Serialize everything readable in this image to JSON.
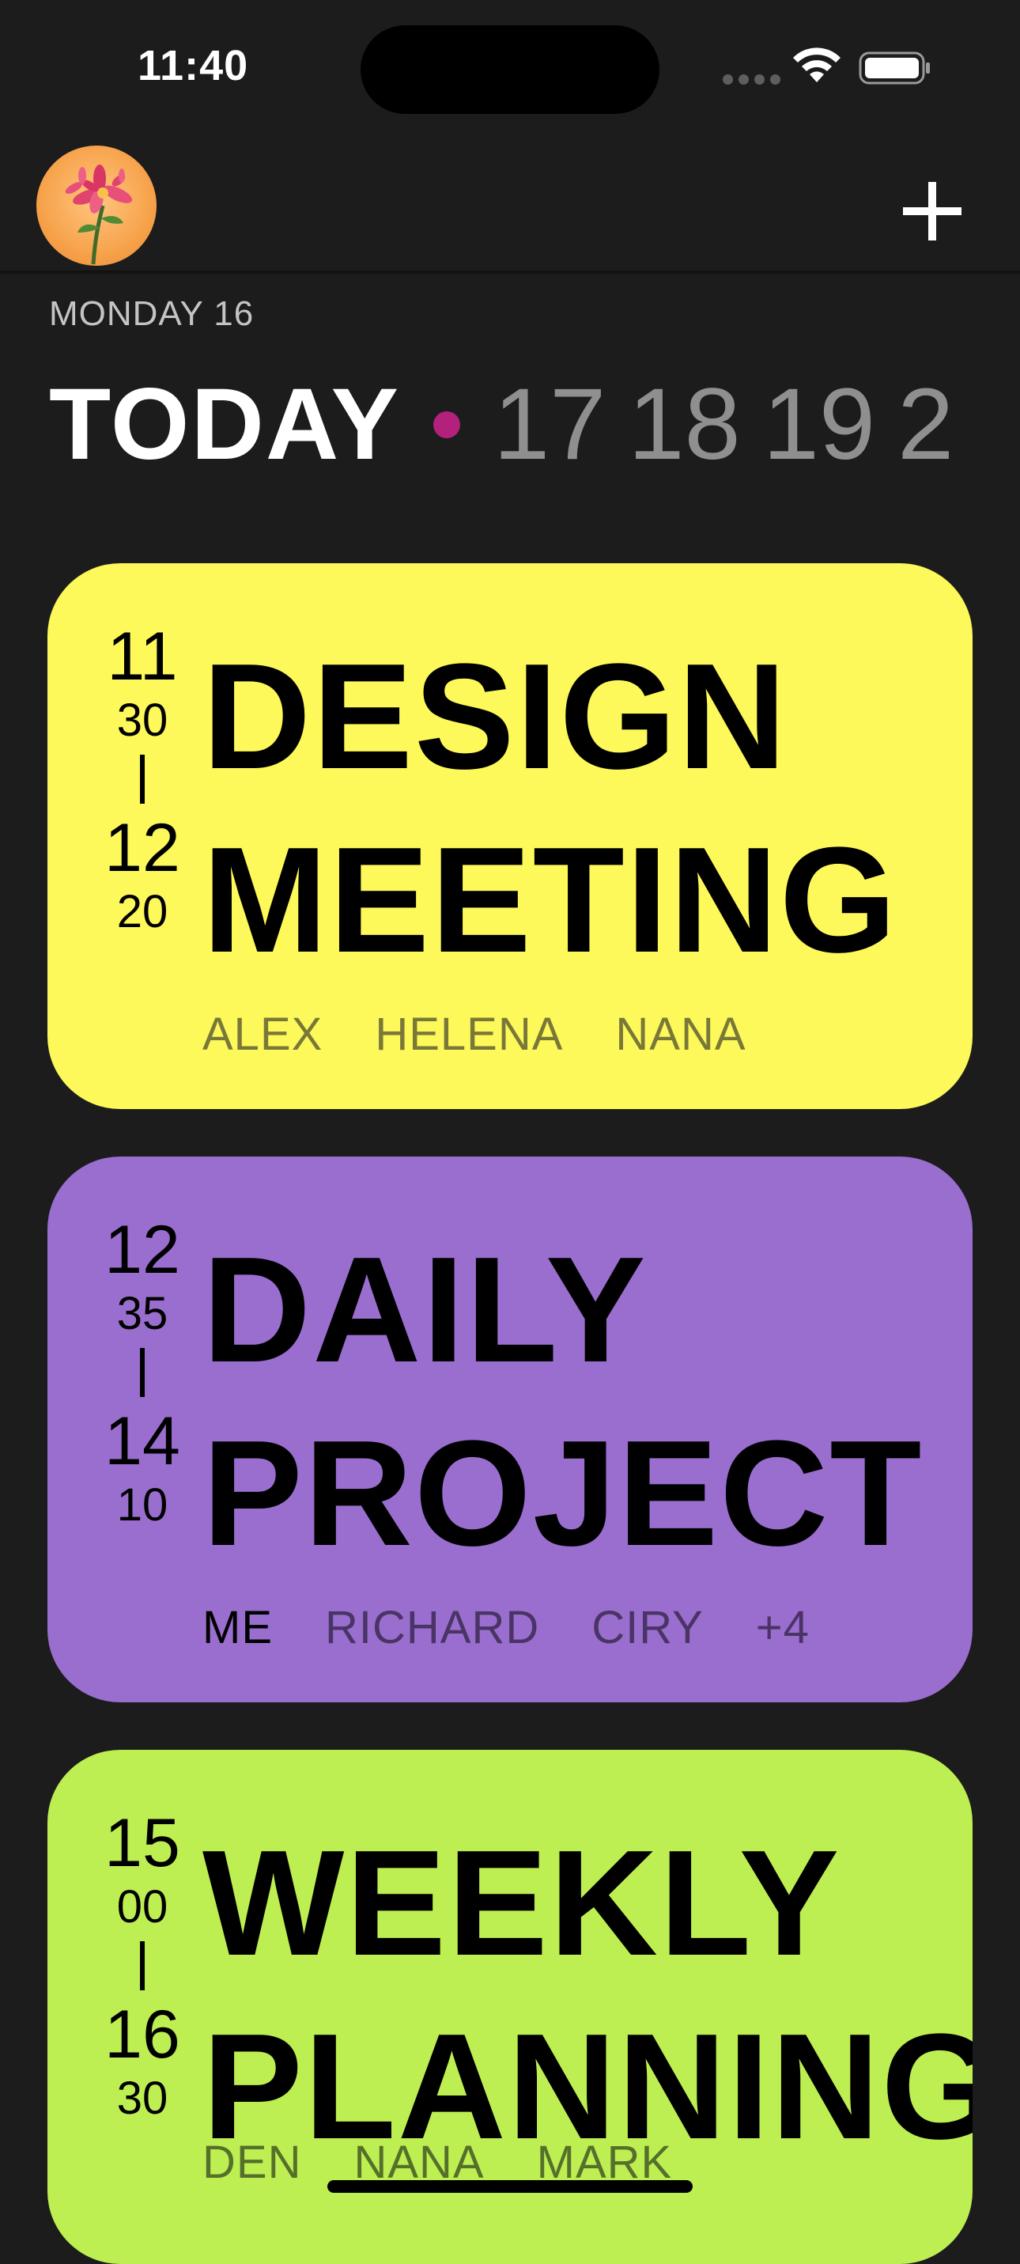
{
  "status_bar": {
    "time": "11:40"
  },
  "header": {
    "avatar_icon": "flower-avatar",
    "add_icon": "plus-icon"
  },
  "date_strip": {
    "day_label": "MONDAY 16",
    "today_label": "TODAY",
    "dates": [
      "17",
      "18",
      "19",
      "2"
    ],
    "accent_dot_color": "#b3217d"
  },
  "events": [
    {
      "color": "#fdf95a",
      "start_hour": "11",
      "start_min": "30",
      "end_hour": "12",
      "end_min": "20",
      "title_line1": "DESIGN",
      "title_line2": "MEETING",
      "attendees": [
        "ALEX",
        "HELENA",
        "NANA"
      ]
    },
    {
      "color": "#9a6ecf",
      "start_hour": "12",
      "start_min": "35",
      "end_hour": "14",
      "end_min": "10",
      "title_line1": "DAILY",
      "title_line2": "PROJECT",
      "attendees": [
        "ME",
        "RICHARD",
        "CIRY",
        "+4"
      ]
    },
    {
      "color": "#beef52",
      "start_hour": "15",
      "start_min": "00",
      "end_hour": "16",
      "end_min": "30",
      "title_line1": "WEEKLY",
      "title_line2": "PLANNING",
      "attendees": [
        "DEN",
        "NANA",
        "MARK"
      ]
    }
  ]
}
